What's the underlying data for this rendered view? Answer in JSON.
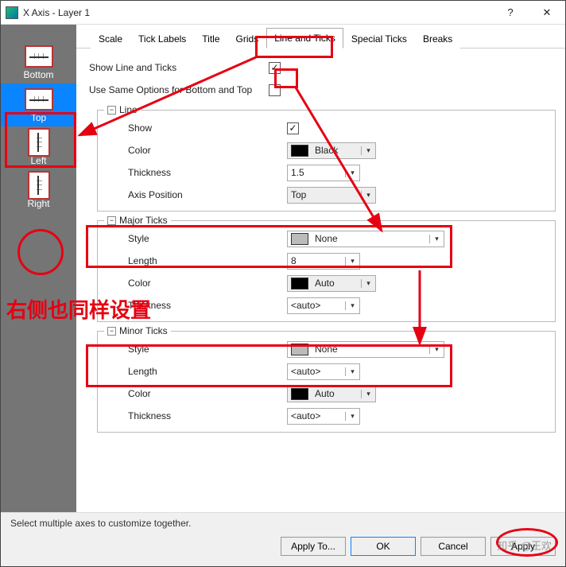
{
  "titlebar": {
    "title": "X Axis - Layer 1",
    "help": "?",
    "close": "✕"
  },
  "leftpane": {
    "items": [
      {
        "label": "Bottom"
      },
      {
        "label": "Top"
      },
      {
        "label": "Left"
      },
      {
        "label": "Right"
      }
    ]
  },
  "tabs": {
    "items": [
      {
        "label": "Scale"
      },
      {
        "label": "Tick Labels"
      },
      {
        "label": "Title"
      },
      {
        "label": "Grids"
      },
      {
        "label": "Line and Ticks"
      },
      {
        "label": "Special Ticks"
      },
      {
        "label": "Breaks"
      }
    ],
    "active": 4
  },
  "form": {
    "show_line_ticks_label": "Show Line and Ticks",
    "use_same_label": "Use Same Options for Bottom and Top",
    "line_legend": "Line",
    "line": {
      "show_label": "Show",
      "color_label": "Color",
      "color_value": "Black",
      "thickness_label": "Thickness",
      "thickness_value": "1.5",
      "axis_pos_label": "Axis Position",
      "axis_pos_value": "Top"
    },
    "major_legend": "Major Ticks",
    "major": {
      "style_label": "Style",
      "style_value": "None",
      "length_label": "Length",
      "length_value": "8",
      "color_label": "Color",
      "color_value": "Auto",
      "thickness_label": "Thickness",
      "thickness_value": "<auto>"
    },
    "minor_legend": "Minor Ticks",
    "minor": {
      "style_label": "Style",
      "style_value": "None",
      "length_label": "Length",
      "length_value": "<auto>",
      "color_label": "Color",
      "color_value": "Auto",
      "thickness_label": "Thickness",
      "thickness_value": "<auto>"
    }
  },
  "footer": {
    "hint": "Select multiple axes to customize together.",
    "apply_to": "Apply To...",
    "ok": "OK",
    "cancel": "Cancel",
    "apply": "Apply"
  },
  "annotation": {
    "text": "右侧也同样设置"
  },
  "glyph": {
    "minus": "−",
    "down": "▾"
  },
  "watermark": "知乎 @王欢"
}
